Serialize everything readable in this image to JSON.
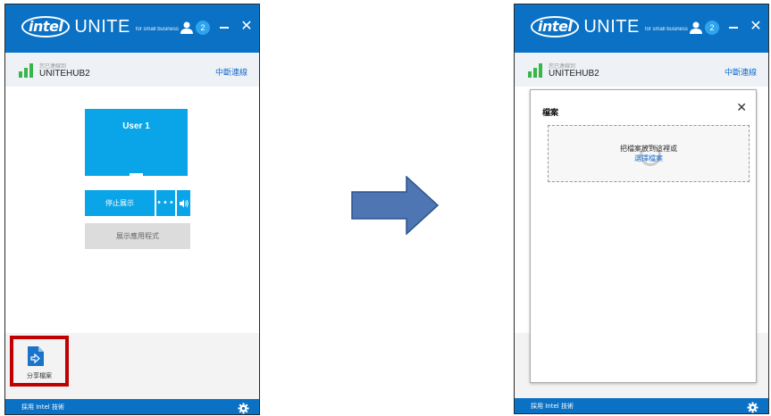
{
  "colors": {
    "brand_blue": "#0a71c5",
    "tile_blue": "#0aa5e8",
    "signal_green": "#39b54a",
    "link_blue": "#1e6fd0",
    "highlight_red": "#c00000",
    "arrow_fill": "#4e76b3"
  },
  "app": {
    "logo_intel": "intel",
    "logo_unite": "UNITE",
    "logo_sub": "for small business",
    "participant_count": "2",
    "close_glyph": "✕"
  },
  "connection": {
    "caption": "您已連線到",
    "hub": "UNITEHUB2",
    "disconnect": "中斷連線"
  },
  "left": {
    "user_tile": "User 1",
    "stop_button": "停止展示",
    "more_button": "•••",
    "show_app_button": "展示應用程式",
    "share_file": "分享檔案"
  },
  "right": {
    "panel_title": "檔案",
    "panel_close": "✕",
    "drop_text": "把檔案放到這裡或",
    "drop_link": "選擇檔案"
  },
  "footer": {
    "text": "採用 Intel 技術"
  },
  "icons": {
    "participants": "person-icon",
    "minimize": "minimize-icon",
    "close": "close-icon",
    "signal": "signal-bars-icon",
    "volume": "speaker-icon",
    "share": "file-arrow-icon",
    "settings": "gear-icon",
    "transition": "right-arrow-icon",
    "loading": "spinner-icon"
  }
}
